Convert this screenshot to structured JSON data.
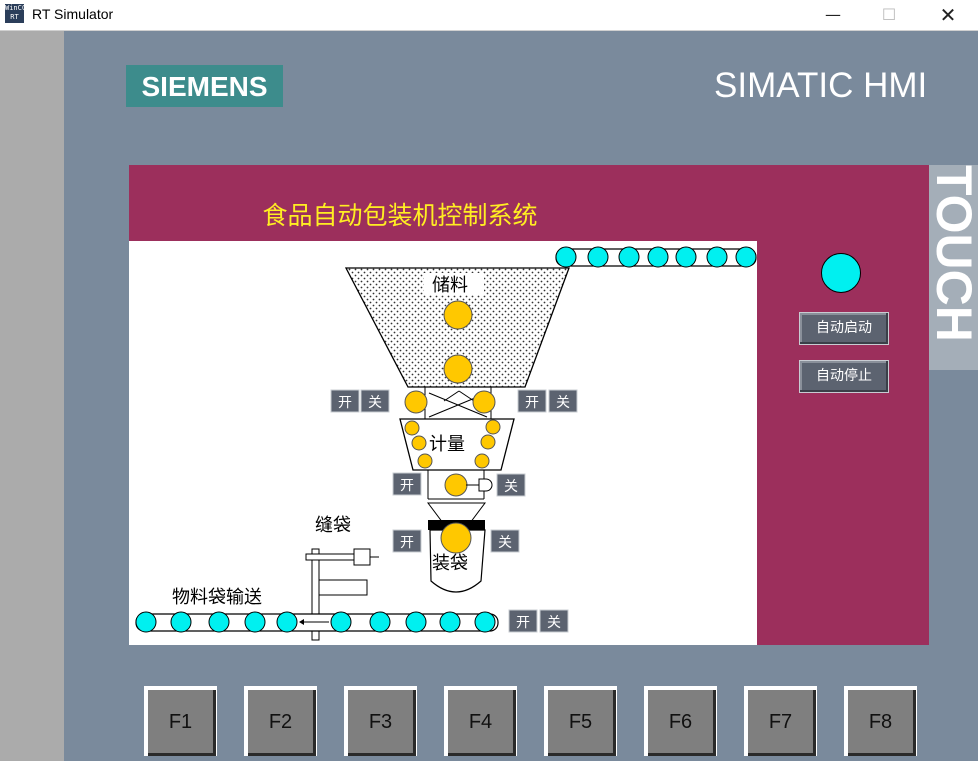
{
  "window": {
    "title": "RT Simulator",
    "icon_text": "WinCC RT",
    "minimize_icon": "minimize-icon",
    "maximize_icon": "maximize-icon",
    "close_icon": "close-icon"
  },
  "device": {
    "brand": "SIEMENS",
    "model": "SIMATIC HMI",
    "side_label": "TOUCH",
    "function_keys": [
      "F1",
      "F2",
      "F3",
      "F4",
      "F5",
      "F6",
      "F7",
      "F8"
    ]
  },
  "screen": {
    "title": "食品自动包装机控制系统",
    "auto_start": "自动启动",
    "auto_stop": "自动停止",
    "status_lamp_color": "#00f0f0",
    "process": {
      "storage_label": "储料",
      "metering_label": "计量",
      "sewing_label": "缝袋",
      "bagging_label": "装袋",
      "conveyor_label": "物料袋输送",
      "open_label": "开",
      "close_label": "关"
    }
  },
  "colors": {
    "screen_bg": "#9c2f5c",
    "title_color": "#ffee22",
    "material_ball": "#ffc800",
    "roller": "#00f0f0",
    "device_body": "#7a8a9c",
    "logo_bg": "#3d8c8c"
  }
}
